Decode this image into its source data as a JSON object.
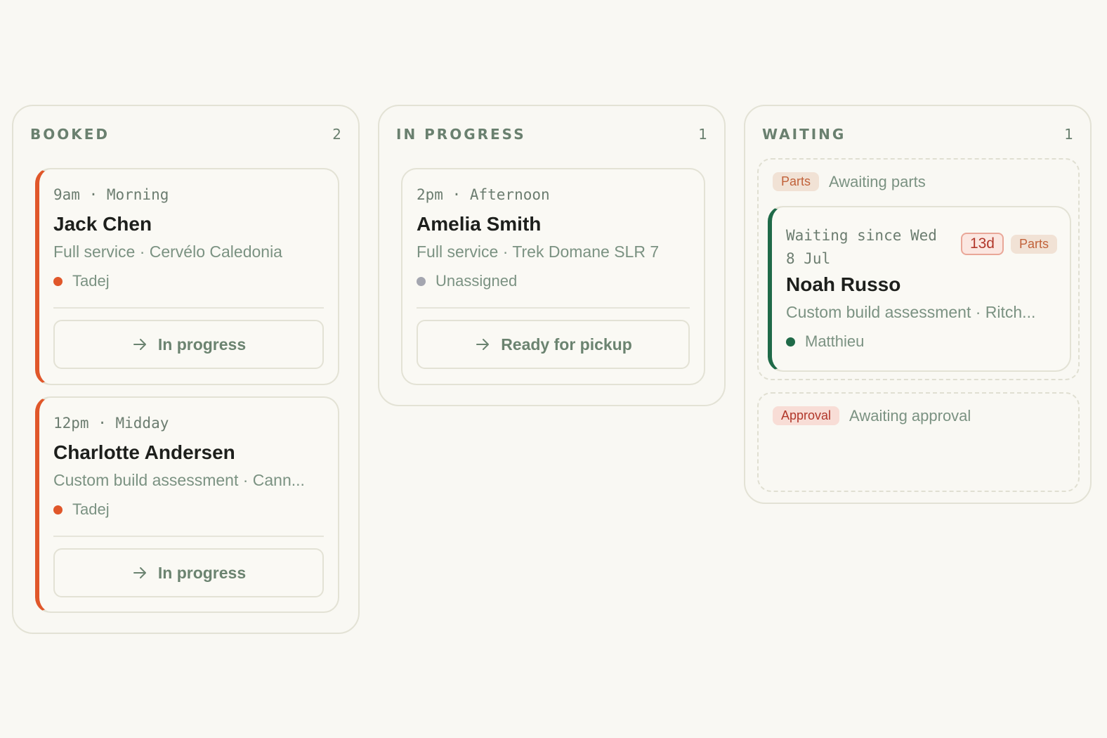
{
  "columns": {
    "booked": {
      "title": "BOOKED",
      "count": "2",
      "cards": [
        {
          "time": "9am · Morning",
          "name": "Jack Chen",
          "description": "Full service · Cervélo Caledonia",
          "assignee": "Tadej",
          "action": "In progress"
        },
        {
          "time": "12pm · Midday",
          "name": "Charlotte Andersen",
          "description": "Custom build assessment · Cann...",
          "assignee": "Tadej",
          "action": "In progress"
        }
      ]
    },
    "in_progress": {
      "title": "IN PROGRESS",
      "count": "1",
      "cards": [
        {
          "time": "2pm · Afternoon",
          "name": "Amelia Smith",
          "description": "Full service · Trek Domane SLR 7",
          "assignee": "Unassigned",
          "action": "Ready for pickup"
        }
      ]
    },
    "waiting": {
      "title": "WAITING",
      "count": "1",
      "groups": [
        {
          "tag": "Parts",
          "label": "Awaiting parts",
          "cards": [
            {
              "time": "Waiting since Wed 8 Jul",
              "days_badge": "13d",
              "tag": "Parts",
              "name": "Noah Russo",
              "description": "Custom build assessment · Ritch...",
              "assignee": "Matthieu"
            }
          ]
        },
        {
          "tag": "Approval",
          "label": "Awaiting approval",
          "cards": []
        }
      ]
    }
  },
  "colors": {
    "background": "#f9f8f3",
    "accent_orange": "#e0572a",
    "accent_green": "#1f6a48",
    "muted_text": "#7b9282",
    "unassigned_dot": "#a4a6b0"
  },
  "icons": {
    "action_arrow": "arrow-right-icon",
    "status_dot": "status-dot-icon"
  }
}
